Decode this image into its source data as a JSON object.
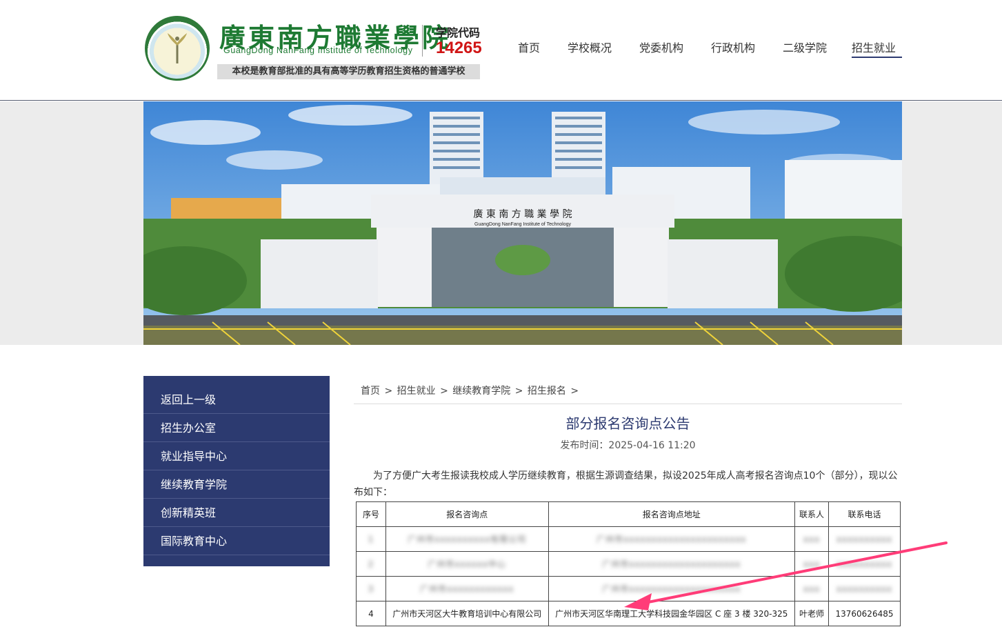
{
  "header": {
    "school_name": "廣東南方職業學院",
    "school_name_en": "GuangDong NanFang Institute of Technology",
    "code_label": "学院代码",
    "code_value": "14265",
    "slogan": "本校是教育部批准的具有高等学历教育招生资格的普通学校",
    "nav": [
      "首页",
      "学校概况",
      "党委机构",
      "行政机构",
      "二级学院",
      "招生就业"
    ],
    "active_nav": "招生就业"
  },
  "banner": {
    "gate_sign": "廣 東 南 方 職 業 學 院",
    "gate_sign_en": "GuangDong NanFang Institute of Technology"
  },
  "sidebar": {
    "items": [
      "返回上一级",
      "招生办公室",
      "就业指导中心",
      "继续教育学院",
      "创新精英班",
      "国际教育中心"
    ]
  },
  "breadcrumb": [
    "首页",
    ">",
    "招生就业",
    ">",
    "继续教育学院",
    ">",
    "招生报名",
    ">"
  ],
  "article": {
    "title": "部分报名咨询点公告",
    "date_label": "发布时间：",
    "date_value": "2025-04-16 11:20",
    "body": "为了方便广大考生报读我校成人学历继续教育，根据生源调查结果，拟设2025年成人高考报名咨询点10个（部分），现以公布如下："
  },
  "table": {
    "headers": [
      "序号",
      "报名咨询点",
      "报名咨询点地址",
      "联系人",
      "联系电话"
    ],
    "blurred_rows": [
      [
        "1",
        "广州市xxxxxxxxxx有限公司",
        "广州市xxxxxxxxxxxxxxxxxxxxxx",
        "xxx",
        "xxxxxxxxxx"
      ],
      [
        "2",
        "广州市xxxxxx中心",
        "广州市xxxxxxxxxxxxxxxxxxxx",
        "xxx",
        "xxxxxxxxxx"
      ],
      [
        "3",
        "广州市xxxxxxxxxxxx",
        "广州市xxxxxxxxxxxxxxxxxxxx",
        "xxx",
        "xxxxxxxxxx"
      ]
    ],
    "rows": [
      [
        "4",
        "广州市天河区大牛教育培训中心有限公司",
        "广州市天河区华南理工大学科技园金华园区 C 座 3 楼 320-325",
        "叶老师",
        "13760626485"
      ]
    ]
  },
  "colors": {
    "primary": "#2c3a70",
    "brand_green": "#1e7a33",
    "code_red": "#d01515",
    "arrow": "#ff3c78"
  }
}
